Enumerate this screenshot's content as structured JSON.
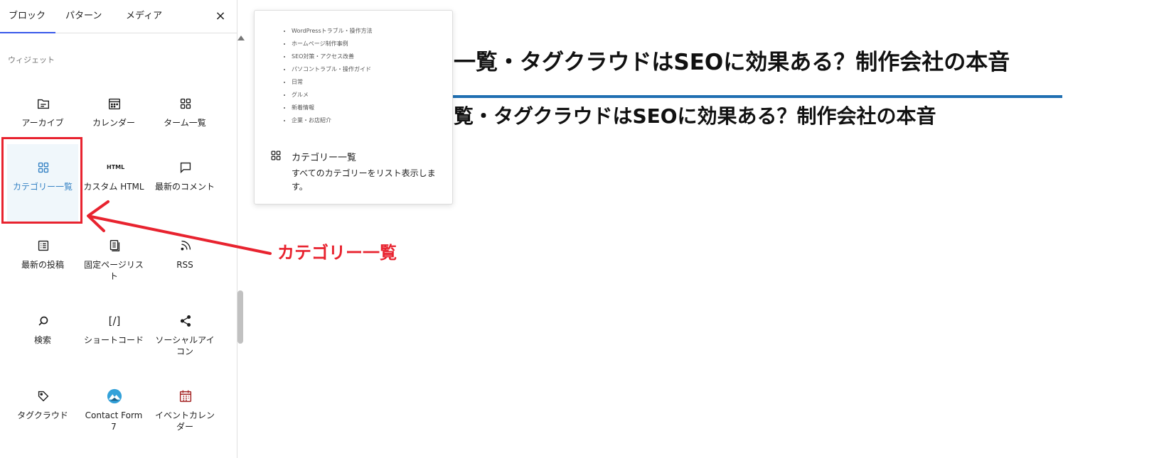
{
  "sidebar": {
    "tabs": [
      {
        "label": "ブロック",
        "active": true
      },
      {
        "label": "パターン",
        "active": false
      },
      {
        "label": "メディア",
        "active": false
      }
    ],
    "close_label": "×",
    "section_label": "ウィジェット",
    "blocks": [
      {
        "label": "アーカイブ",
        "icon": "archive-icon"
      },
      {
        "label": "カレンダー",
        "icon": "calendar-icon"
      },
      {
        "label": "ターム一覧",
        "icon": "terms-list-icon"
      },
      {
        "label": "カテゴリー一覧",
        "icon": "categories-icon",
        "selected": true
      },
      {
        "label": "カスタム HTML",
        "icon": "html-icon",
        "icon_text": "HTML"
      },
      {
        "label": "最新のコメント",
        "icon": "comment-icon"
      },
      {
        "label": "最新の投稿",
        "icon": "latest-posts-icon"
      },
      {
        "label": "固定ページリスト",
        "icon": "page-list-icon"
      },
      {
        "label": "RSS",
        "icon": "rss-icon"
      },
      {
        "label": "検索",
        "icon": "search-icon"
      },
      {
        "label": "ショートコード",
        "icon": "shortcode-icon",
        "icon_text": "[/]"
      },
      {
        "label": "ソーシャルアイコン",
        "icon": "share-icon"
      },
      {
        "label": "タグクラウド",
        "icon": "tag-icon"
      },
      {
        "label": "Contact Form 7",
        "icon": "contact-form-7-icon"
      },
      {
        "label": "イベントカレンダー",
        "icon": "event-calendar-icon"
      }
    ]
  },
  "preview": {
    "items": [
      "WordPressトラブル・操作方法",
      "ホームページ制作事例",
      "SEO対策・アクセス改善",
      "パソコントラブル・操作ガイド",
      "日常",
      "グルメ",
      "新着情報",
      "企業・お店紹介"
    ],
    "title": "カテゴリー一覧",
    "description": "すべてのカテゴリーをリスト表示します。"
  },
  "content": {
    "heading1": "一覧・タグクラウドはSEOに効果ある？制作会社の本音",
    "heading2": "覧・タグクラウドはSEOに効果ある？制作会社の本音"
  },
  "annotation": {
    "text": "カテゴリー一覧",
    "color": "#e8232f"
  },
  "colors": {
    "accent": "#3582c4",
    "content_rule": "#1f6fb2",
    "tab_indicator": "#3858e9"
  }
}
